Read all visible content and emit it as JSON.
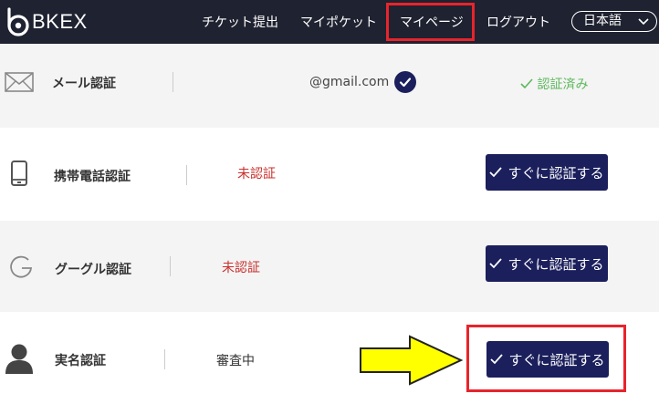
{
  "brand": {
    "name": "BKEX"
  },
  "nav": {
    "items": [
      {
        "label": "チケット提出"
      },
      {
        "label": "マイポケット"
      },
      {
        "label": "マイページ"
      },
      {
        "label": "ログアウト"
      }
    ],
    "language": "日本語"
  },
  "verification": {
    "email": {
      "label": "メール認証",
      "value": "@gmail.com",
      "status": "認証済み"
    },
    "phone": {
      "label": "携帯電話認証",
      "status": "未認証",
      "button": "すぐに認証する"
    },
    "google": {
      "label": "グーグル認証",
      "status": "未認証",
      "button": "すぐに認証する"
    },
    "identity": {
      "label": "実名認証",
      "status": "審査中",
      "button": "すぐに認証する"
    }
  },
  "colors": {
    "header_bg": "#1f2230",
    "button_bg": "#1b1f5c",
    "highlight": "#e8242c",
    "arrow_fill": "#ffff00",
    "status_unverified": "#c9302c",
    "status_verified": "#5cb85c"
  },
  "icons": {
    "email": "mail-icon",
    "phone": "mobile-phone-icon",
    "google": "google-g-icon",
    "identity": "user-icon"
  }
}
